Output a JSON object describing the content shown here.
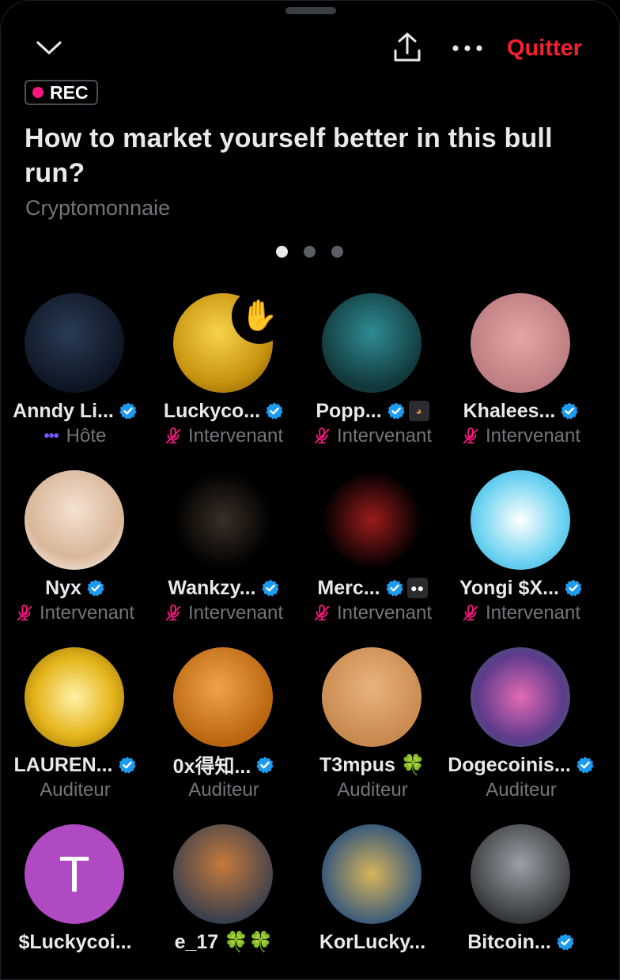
{
  "header": {
    "quit_label": "Quitter",
    "icons": [
      "chevron-down-icon",
      "share-icon",
      "more-icon"
    ]
  },
  "space": {
    "rec_label": "REC",
    "title": "How to market yourself better in this bull run?",
    "category": "Cryptomonnaie",
    "pages": 3,
    "active_page": 1
  },
  "colors": {
    "accent_red": "#f4212e",
    "rec_pink": "#f91880",
    "verified_blue": "#1d9bf0",
    "host_purple": "#7856ff",
    "muted_text": "#71767b"
  },
  "participants": [
    {
      "name": "Anndy Li...",
      "role": "Hôte"
    },
    {
      "name": "Luckyco...",
      "role": "Intervenant",
      "hand_raised": true
    },
    {
      "name": "Popp...",
      "role": "Intervenant"
    },
    {
      "name": "Khalees...",
      "role": "Intervenant"
    },
    {
      "name": "Nyx",
      "role": "Intervenant"
    },
    {
      "name": "Wankzy...",
      "role": "Intervenant"
    },
    {
      "name": "Merc...",
      "role": "Intervenant"
    },
    {
      "name": "Yongi $X...",
      "role": "Intervenant"
    },
    {
      "name": "LAUREN...",
      "role": "Auditeur"
    },
    {
      "name": "0x得知...",
      "role": "Auditeur"
    },
    {
      "name": "T3mpus 🍀",
      "role": "Auditeur"
    },
    {
      "name": "Dogecoinis...",
      "role": "Auditeur"
    },
    {
      "name": "$Luckycoi...",
      "role": "",
      "avatar_letter": "T"
    },
    {
      "name": "e_17 🍀🍀",
      "role": ""
    },
    {
      "name": "KorLucky...",
      "role": ""
    },
    {
      "name": "Bitcoin...",
      "role": ""
    }
  ]
}
